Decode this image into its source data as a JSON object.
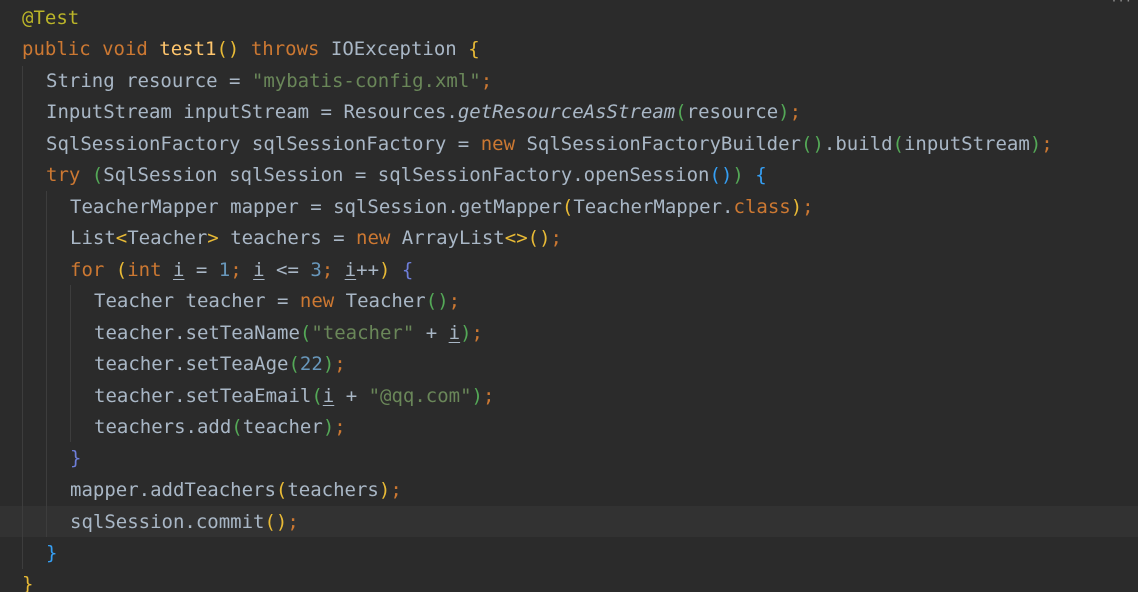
{
  "editor": {
    "corner_mark": "···",
    "colors": {
      "background": "#2b2b2b",
      "current_line": "#323232",
      "keyword": "#cc7832",
      "string": "#6a8759",
      "number": "#6897bb",
      "method_declaration": "#ffc66d",
      "annotation": "#bbb529",
      "plain_text": "#a9b7c6",
      "bracket_level_1": "#e8ba36",
      "bracket_level_2": "#54a857",
      "bracket_level_3": "#359ff4",
      "bracket_level_4": "#6e7ed9"
    },
    "lines": [
      [
        [
          "annot",
          "@Test"
        ]
      ],
      [
        [
          "kw",
          "public "
        ],
        [
          "kw",
          "void "
        ],
        [
          "fn",
          "test1"
        ],
        [
          "p1",
          "()"
        ],
        [
          "text",
          " "
        ],
        [
          "kw",
          "throws "
        ],
        [
          "type",
          "IOException "
        ],
        [
          "p1",
          "{"
        ]
      ],
      [
        [
          "type",
          "String "
        ],
        [
          "text",
          "resource = "
        ],
        [
          "str",
          "\"mybatis-config.xml\""
        ],
        [
          "kw",
          ";"
        ]
      ],
      [
        [
          "type",
          "InputStream "
        ],
        [
          "text",
          "inputStream = "
        ],
        [
          "type",
          "Resources."
        ],
        [
          "static",
          "getResourceAsStream"
        ],
        [
          "p2",
          "("
        ],
        [
          "text",
          "resource"
        ],
        [
          "p2",
          ")"
        ],
        [
          "kw",
          ";"
        ]
      ],
      [
        [
          "type",
          "SqlSessionFactory "
        ],
        [
          "text",
          "sqlSessionFactory = "
        ],
        [
          "kw",
          "new "
        ],
        [
          "type",
          "SqlSessionFactoryBuilder"
        ],
        [
          "p2",
          "()"
        ],
        [
          "text",
          ".build"
        ],
        [
          "p2",
          "("
        ],
        [
          "text",
          "inputStream"
        ],
        [
          "p2",
          ")"
        ],
        [
          "kw",
          ";"
        ]
      ],
      [
        [
          "kw",
          "try "
        ],
        [
          "p2",
          "("
        ],
        [
          "type",
          "SqlSession "
        ],
        [
          "text",
          "sqlSession = sqlSessionFactory.openSession"
        ],
        [
          "p3",
          "()"
        ],
        [
          "p2",
          ")"
        ],
        [
          "text",
          " "
        ],
        [
          "p3",
          "{"
        ]
      ],
      [
        [
          "type",
          "TeacherMapper "
        ],
        [
          "text",
          "mapper = sqlSession.getMapper"
        ],
        [
          "p1",
          "("
        ],
        [
          "type",
          "TeacherMapper."
        ],
        [
          "kw",
          "class"
        ],
        [
          "p1",
          ")"
        ],
        [
          "kw",
          ";"
        ]
      ],
      [
        [
          "type",
          "List"
        ],
        [
          "p1",
          "<"
        ],
        [
          "type",
          "Teacher"
        ],
        [
          "p1",
          ">"
        ],
        [
          "text",
          " teachers = "
        ],
        [
          "kw",
          "new "
        ],
        [
          "type",
          "ArrayList"
        ],
        [
          "p1",
          "<>"
        ],
        [
          "p1",
          "()"
        ],
        [
          "kw",
          ";"
        ]
      ],
      [
        [
          "kw",
          "for "
        ],
        [
          "p1",
          "("
        ],
        [
          "kw",
          "int "
        ],
        [
          "var",
          "i"
        ],
        [
          "text",
          " = "
        ],
        [
          "num",
          "1"
        ],
        [
          "kw",
          "; "
        ],
        [
          "var",
          "i"
        ],
        [
          "text",
          " <= "
        ],
        [
          "num",
          "3"
        ],
        [
          "kw",
          "; "
        ],
        [
          "var",
          "i"
        ],
        [
          "text",
          "++"
        ],
        [
          "p1",
          ")"
        ],
        [
          "text",
          " "
        ],
        [
          "p4",
          "{"
        ]
      ],
      [
        [
          "type",
          "Teacher "
        ],
        [
          "text",
          "teacher = "
        ],
        [
          "kw",
          "new "
        ],
        [
          "type",
          "Teacher"
        ],
        [
          "p2",
          "()"
        ],
        [
          "kw",
          ";"
        ]
      ],
      [
        [
          "text",
          "teacher.setTeaName"
        ],
        [
          "p2",
          "("
        ],
        [
          "str",
          "\"teacher\""
        ],
        [
          "text",
          " + "
        ],
        [
          "var",
          "i"
        ],
        [
          "p2",
          ")"
        ],
        [
          "kw",
          ";"
        ]
      ],
      [
        [
          "text",
          "teacher.setTeaAge"
        ],
        [
          "p2",
          "("
        ],
        [
          "num",
          "22"
        ],
        [
          "p2",
          ")"
        ],
        [
          "kw",
          ";"
        ]
      ],
      [
        [
          "text",
          "teacher.setTeaEmail"
        ],
        [
          "p2",
          "("
        ],
        [
          "var",
          "i"
        ],
        [
          "text",
          " + "
        ],
        [
          "str",
          "\"@qq.com\""
        ],
        [
          "p2",
          ")"
        ],
        [
          "kw",
          ";"
        ]
      ],
      [
        [
          "text",
          "teachers.add"
        ],
        [
          "p2",
          "("
        ],
        [
          "text",
          "teacher"
        ],
        [
          "p2",
          ")"
        ],
        [
          "kw",
          ";"
        ]
      ],
      [
        [
          "p4",
          "}"
        ]
      ],
      [
        [
          "text",
          "mapper.addTeachers"
        ],
        [
          "p1",
          "("
        ],
        [
          "text",
          "teachers"
        ],
        [
          "p1",
          ")"
        ],
        [
          "kw",
          ";"
        ]
      ],
      [
        [
          "text",
          "sqlSession.commit"
        ],
        [
          "p1",
          "()"
        ],
        [
          "kw",
          ";"
        ]
      ],
      [
        [
          "p3",
          "}"
        ]
      ],
      [
        [
          "p1",
          "}"
        ]
      ]
    ]
  }
}
